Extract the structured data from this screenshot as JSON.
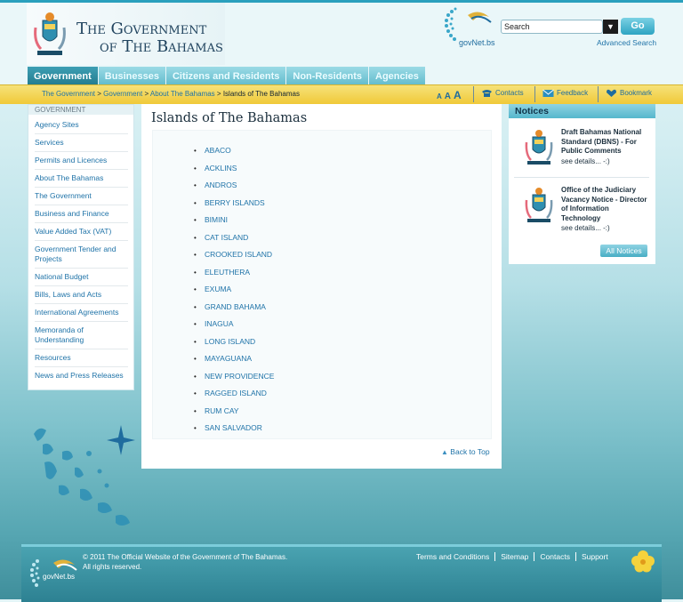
{
  "header": {
    "title_line1": "The Government",
    "title_line2": "of The Bahamas",
    "govnet_logo": "govNet.bs",
    "search_placeholder": "Search",
    "search_value": "Search",
    "go_label": "Go",
    "advanced_search": "Advanced Search",
    "dropdown_icon": "▼"
  },
  "nav": {
    "tabs": [
      "Government",
      "Businesses",
      "Citizens and Residents",
      "Non-Residents",
      "Agencies"
    ],
    "active": "Government"
  },
  "breadcrumb": {
    "items": [
      "The Government",
      "Government",
      "About The Bahamas"
    ],
    "separator": ">",
    "current": "Islands of The Bahamas"
  },
  "font_sizes": [
    "A",
    "A",
    "A"
  ],
  "utility_links": {
    "contacts": "Contacts",
    "feedback": "Feedback",
    "bookmark": "Bookmark"
  },
  "sidebar": {
    "heading": "GOVERNMENT",
    "items": [
      "Agency Sites",
      "Services",
      "Permits and Licences",
      "About The Bahamas",
      "The Government",
      "Business and Finance",
      "Value Added Tax (VAT)",
      "Government Tender and Projects",
      "National Budget",
      "Bills, Laws and Acts",
      "International Agreements",
      "Memoranda of Understanding",
      "Resources",
      "News and Press Releases"
    ]
  },
  "main": {
    "title": "Islands of The Bahamas",
    "islands": [
      "ABACO",
      "ACKLINS",
      "ANDROS",
      "BERRY ISLANDS",
      "BIMINI",
      "CAT ISLAND",
      "CROOKED ISLAND",
      "ELEUTHERA",
      "EXUMA",
      "GRAND BAHAMA",
      "INAGUA",
      "LONG ISLAND",
      "MAYAGUANA",
      "NEW PROVIDENCE",
      "RAGGED ISLAND",
      "RUM CAY",
      "SAN SALVADOR"
    ],
    "back_to_top": "Back to Top"
  },
  "notices": {
    "heading": "Notices",
    "items": [
      {
        "title": "Draft Bahamas National Standard (DBNS) - For Public Comments",
        "more": "see details... -:)"
      },
      {
        "title": "Office of the Judiciary Vacancy Notice - Director of Information Technology",
        "more": "see details... -:)"
      }
    ],
    "all_label": "All Notices"
  },
  "footer": {
    "logo": "govNet.bs",
    "copyright_line1": "© 2011 The Official Website of the Government of The Bahamas.",
    "copyright_line2": "All rights reserved.",
    "links": [
      "Terms and Conditions",
      "Sitemap",
      "Contacts",
      "Support"
    ]
  },
  "colors": {
    "accent": "#2ea4c2",
    "crumbbar": "#f0c938",
    "link": "#1f73a8"
  }
}
